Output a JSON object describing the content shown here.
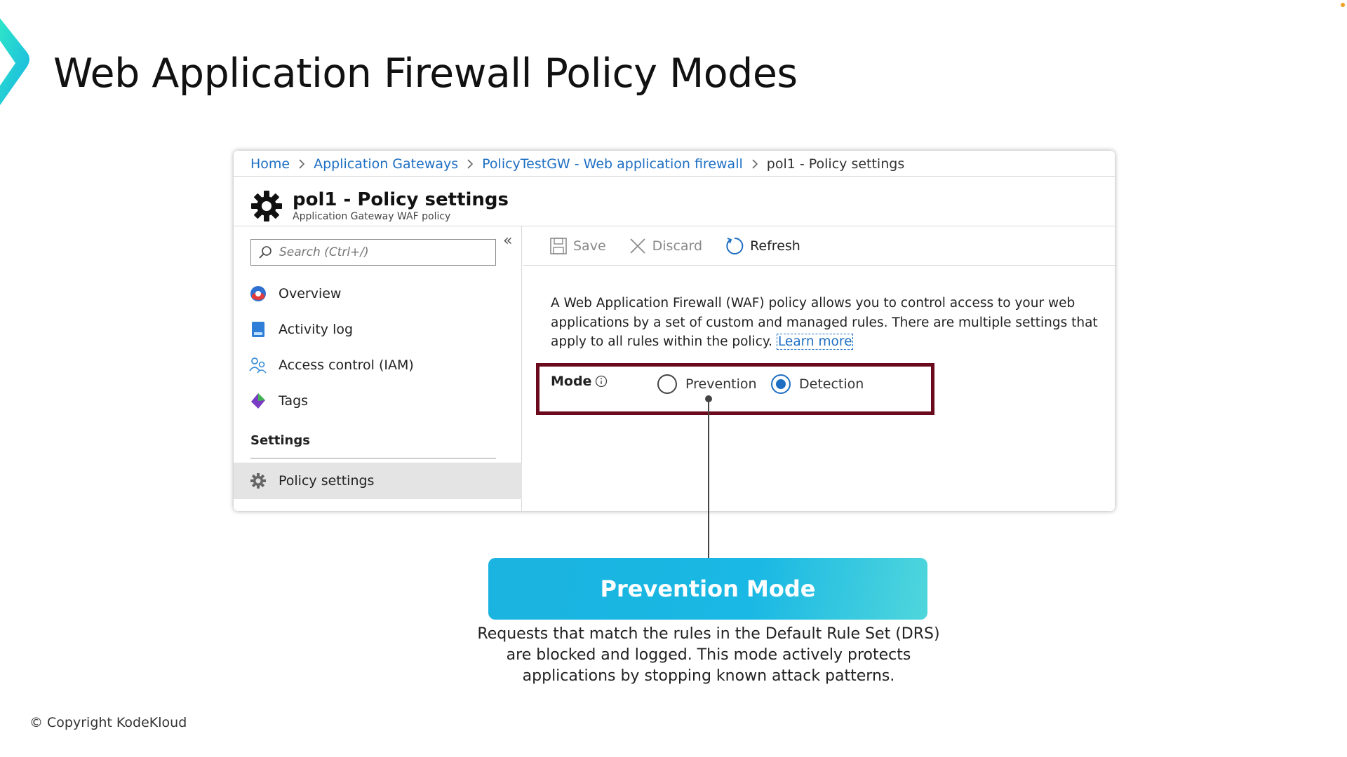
{
  "slide": {
    "title": "Web Application Firewall Policy Modes",
    "copyright": "© Copyright KodeKloud"
  },
  "breadcrumb": {
    "items": [
      "Home",
      "Application Gateways",
      "PolicyTestGW - Web application firewall"
    ],
    "current": "pol1 - Policy settings"
  },
  "header": {
    "title": "pol1 - Policy settings",
    "subtitle": "Application Gateway WAF policy",
    "icon": "gear-icon"
  },
  "sidebar": {
    "search_placeholder": "Search (Ctrl+/)",
    "collapse_label": "«",
    "items": [
      {
        "label": "Overview",
        "icon": "overview-icon"
      },
      {
        "label": "Activity log",
        "icon": "activity-log-icon"
      },
      {
        "label": "Access control (IAM)",
        "icon": "iam-icon"
      },
      {
        "label": "Tags",
        "icon": "tag-icon"
      }
    ],
    "section_label": "Settings",
    "active_item": {
      "label": "Policy settings",
      "icon": "gear-icon"
    }
  },
  "toolbar": {
    "save_label": "Save",
    "discard_label": "Discard",
    "refresh_label": "Refresh"
  },
  "content": {
    "description": "A Web Application Firewall (WAF) policy allows you to control access to your web applications by a set of custom and managed rules. There are multiple settings that apply to all rules within the policy.",
    "learn_more": "Learn more",
    "mode_label": "Mode",
    "mode_options": [
      "Prevention",
      "Detection"
    ],
    "mode_selected": "Detection"
  },
  "callout": {
    "title": "Prevention Mode",
    "description": "Requests that match the rules in the Default Rule Set (DRS) are blocked and logged. This mode actively protects applications by stopping known attack patterns."
  },
  "colors": {
    "accent_blue": "#1e6fc3",
    "highlight_border": "#6b0a1c",
    "callout_gradient_start": "#1bb3e0",
    "callout_gradient_end": "#4fd6dc"
  }
}
